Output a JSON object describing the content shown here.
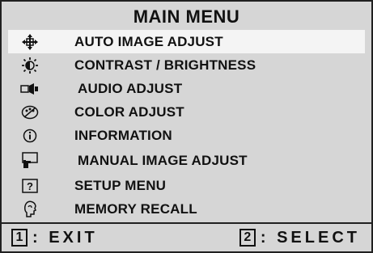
{
  "menu": {
    "title": "MAIN MENU",
    "items": [
      {
        "label": "AUTO IMAGE ADJUST",
        "icon": "position-arrows-icon",
        "selected": true
      },
      {
        "label": "CONTRAST / BRIGHTNESS",
        "icon": "brightness-icon",
        "selected": false
      },
      {
        "label": "AUDIO ADJUST",
        "icon": "speaker-icon",
        "selected": false
      },
      {
        "label": "COLOR ADJUST",
        "icon": "color-palette-icon",
        "selected": false
      },
      {
        "label": "INFORMATION",
        "icon": "info-icon",
        "selected": false
      },
      {
        "label": "MANUAL IMAGE ADJUST",
        "icon": "monitor-hand-icon",
        "selected": false
      },
      {
        "label": "SETUP MENU",
        "icon": "help-question-icon",
        "selected": false
      },
      {
        "label": "MEMORY RECALL",
        "icon": "memory-head-icon",
        "selected": false
      }
    ]
  },
  "footer": {
    "exit_key": "1",
    "exit_label": ": EXIT",
    "select_key": "2",
    "select_label": ": SELECT"
  },
  "colors": {
    "background": "#d6d6d6",
    "text": "#111111",
    "highlight": "#f4f4f4"
  }
}
